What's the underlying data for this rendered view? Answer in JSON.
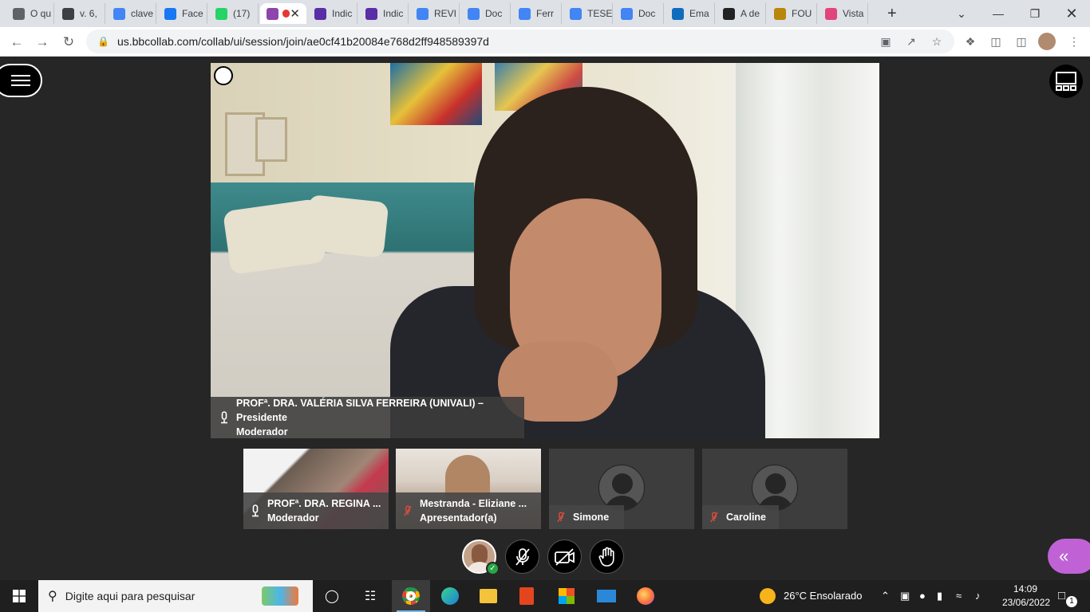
{
  "browser": {
    "tabs": [
      {
        "label": "O qu",
        "color": "#5f6368",
        "icon": "chrome-icon"
      },
      {
        "label": "v. 6,",
        "color": "#3c4043",
        "icon": "pkp-icon"
      },
      {
        "label": "clave",
        "color": "#4285f4",
        "icon": "google-icon"
      },
      {
        "label": "Face",
        "color": "#1877f2",
        "icon": "facebook-icon"
      },
      {
        "label": "(17)",
        "color": "#25d366",
        "icon": "whatsapp-icon"
      },
      {
        "label": "",
        "color": "#8e44ad",
        "icon": "collaborate-icon",
        "active": true
      },
      {
        "label": "Indic",
        "color": "#5a2ea6",
        "icon": "index-icon"
      },
      {
        "label": "Indic",
        "color": "#5a2ea6",
        "icon": "index-icon"
      },
      {
        "label": "REVI",
        "color": "#4285f4",
        "icon": "docs-icon"
      },
      {
        "label": "Doc",
        "color": "#4285f4",
        "icon": "docs-icon"
      },
      {
        "label": "Ferr",
        "color": "#4285f4",
        "icon": "docs-icon"
      },
      {
        "label": "TESE",
        "color": "#4285f4",
        "icon": "docs-icon"
      },
      {
        "label": "Doc",
        "color": "#4285f4",
        "icon": "docs-icon"
      },
      {
        "label": "Ema",
        "color": "#0f6cbd",
        "icon": "outlook-icon"
      },
      {
        "label": "A de",
        "color": "#222222",
        "icon": "newspaper-icon"
      },
      {
        "label": "FOU",
        "color": "#b8860b",
        "icon": "crest-icon"
      },
      {
        "label": "Vista",
        "color": "#e0457b",
        "icon": "vista-icon"
      }
    ],
    "new_tab": "+",
    "url": "us.bbcollab.com/collab/ui/session/join/ae0cf41b20084e768d2ff948589397d"
  },
  "session": {
    "main_video": {
      "name_line1": "PROFª. DRA. VALÉRIA SILVA FERREIRA (UNIVALI) – Presidente",
      "name_line2": "Moderador"
    },
    "participants": [
      {
        "name": "PROFª. DRA. REGINA ...",
        "role": "Moderador",
        "type": "video",
        "muted": false
      },
      {
        "name": "Mestranda - Eliziane ...",
        "role": "Apresentador(a)",
        "type": "video",
        "muted": true
      },
      {
        "name": "Simone",
        "role": "",
        "type": "avatar",
        "muted": true
      },
      {
        "name": "Caroline",
        "role": "",
        "type": "avatar",
        "muted": true
      }
    ]
  },
  "taskbar": {
    "search_placeholder": "Digite aqui para pesquisar",
    "weather": "26°C  Ensolarado",
    "time": "14:09",
    "date": "23/06/2022",
    "notifications": "1"
  }
}
